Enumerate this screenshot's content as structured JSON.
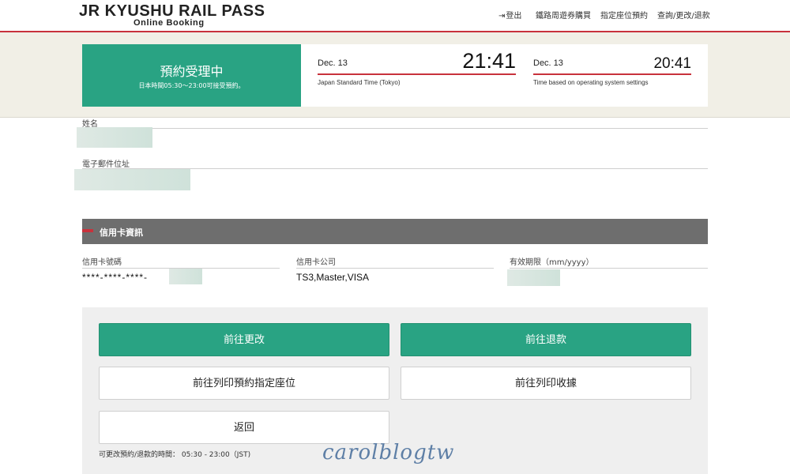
{
  "header": {
    "logo_main": "JR KYUSHU RAIL PASS",
    "logo_sub": "Online Booking",
    "nav": {
      "logout_icon": "logout-icon",
      "logout": "登出",
      "buy_pass": "鐵路周遊券購買",
      "reserve_seat": "指定座位預約",
      "inquiry": "查詢/更改/退款"
    }
  },
  "status": {
    "title": "預約受理中",
    "subtitle": "日本時間05:30～23:00可接受預約。"
  },
  "clocks": {
    "japan": {
      "date": "Dec. 13",
      "time": "21:41",
      "note": "Japan Standard Time (Tokyo)"
    },
    "local": {
      "date": "Dec. 13",
      "time": "20:41",
      "note": "Time based on operating system settings"
    }
  },
  "customer": {
    "name_label": "姓名",
    "email_label": "電子郵件位址"
  },
  "credit_card": {
    "section_title": "信用卡資訊",
    "number_label": "信用卡號碼",
    "number_value": "****-****-****-",
    "company_label": "信用卡公司",
    "company_value": "TS3,Master,VISA",
    "expiry_label": "有效期限（mm/yyyy）"
  },
  "actions": {
    "change": "前往更改",
    "refund": "前往退款",
    "print_seat": "前往列印預約指定座位",
    "print_receipt": "前往列印收據",
    "back": "返回",
    "note": "可更改預約/退款的時間： 05:30 - 23:00（JST)"
  },
  "watermark": "carolblogtw",
  "colors": {
    "accent_green": "#29a383",
    "accent_red": "#c8323c",
    "section_gray": "#6e6e6e",
    "band_beige": "#f1efe6"
  }
}
